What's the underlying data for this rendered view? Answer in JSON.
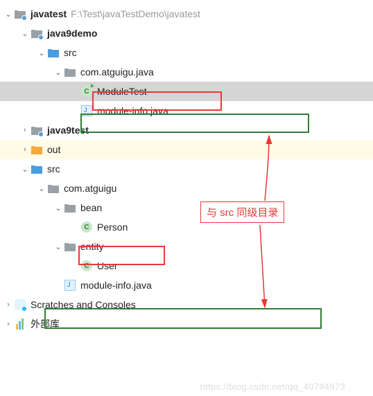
{
  "root": {
    "name": "javatest",
    "path": "F:\\Test\\javaTestDemo\\javatest"
  },
  "nodes": [
    {
      "label": "java9demo",
      "bold": true
    },
    {
      "label": "src"
    },
    {
      "label": "com.atguigu.java"
    },
    {
      "label": "ModuleTest"
    },
    {
      "label": "module-info.java"
    },
    {
      "label": "java9test",
      "bold": true
    },
    {
      "label": "out"
    },
    {
      "label": "src"
    },
    {
      "label": "com.atguigu"
    },
    {
      "label": "bean"
    },
    {
      "label": "Person"
    },
    {
      "label": "entity"
    },
    {
      "label": "User"
    },
    {
      "label": "module-info.java"
    },
    {
      "label": "Scratches and Consoles"
    },
    {
      "label": "外部库"
    }
  ],
  "callout": "与 src 同级目录",
  "watermark": "https://blog.csdn.net/qq_40794973"
}
